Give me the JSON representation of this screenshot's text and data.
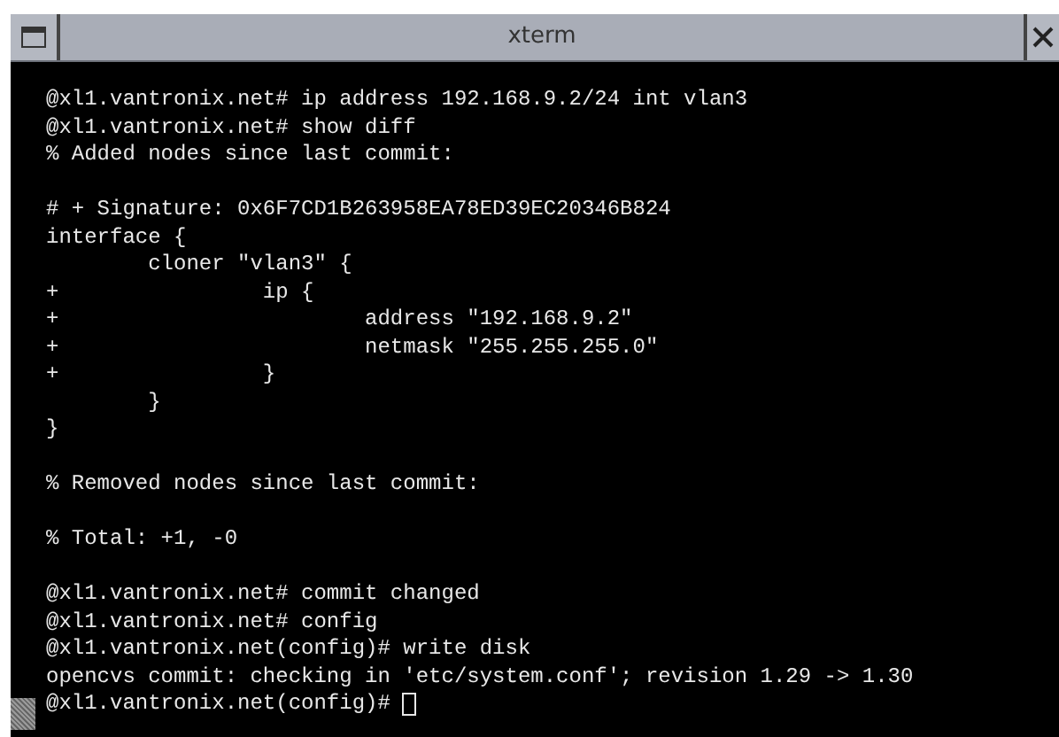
{
  "window": {
    "title": "xterm"
  },
  "terminal": {
    "blocks": [
      [
        "@xl1.vantronix.net# ip address 192.168.9.2/24 int vlan3",
        "@xl1.vantronix.net# show diff",
        "% Added nodes since last commit:"
      ],
      [
        "# + Signature: 0x6F7CD1B263958EA78ED39EC20346B824",
        "interface {",
        "        cloner \"vlan3\" {",
        "+                ip {",
        "+                        address \"192.168.9.2\"",
        "+                        netmask \"255.255.255.0\"",
        "+                }",
        "        }",
        "}"
      ],
      [
        "% Removed nodes since last commit:"
      ],
      [
        "% Total: +1, -0"
      ],
      [
        "@xl1.vantronix.net# commit changed",
        "@xl1.vantronix.net# config",
        "@xl1.vantronix.net(config)# write disk",
        "opencvs commit: checking in 'etc/system.conf'; revision 1.29 -> 1.30"
      ]
    ],
    "prompt": "@xl1.vantronix.net(config)#"
  }
}
